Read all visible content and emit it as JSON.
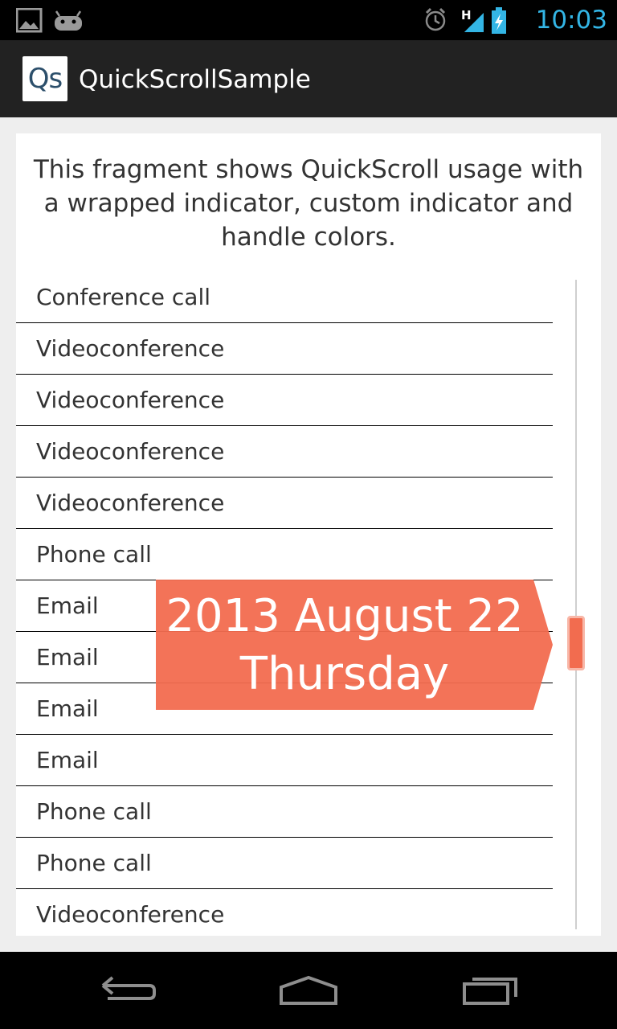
{
  "status_bar": {
    "time": "10:03",
    "icons": [
      "gallery-icon",
      "android-icon",
      "alarm-icon",
      "signal-h-icon",
      "battery-charging-icon"
    ]
  },
  "action_bar": {
    "logo_text": "Qs",
    "title": "QuickScrollSample"
  },
  "content": {
    "intro": "This fragment shows QuickScroll usage with a wrapped indicator, custom indicator and handle colors.",
    "list_items": [
      "Conference call",
      "Videoconference",
      "Videoconference",
      "Videoconference",
      "Videoconference",
      "Phone call",
      "Email",
      "Email",
      "Email",
      "Email",
      "Phone call",
      "Phone call",
      "Videoconference"
    ],
    "indicator": {
      "line1": "2013 August 22",
      "line2": "Thursday",
      "color": "#f26c4f"
    },
    "handle_color": "#f26c4f"
  },
  "nav_bar": {
    "buttons": [
      "back-icon",
      "home-icon",
      "recents-icon"
    ]
  }
}
